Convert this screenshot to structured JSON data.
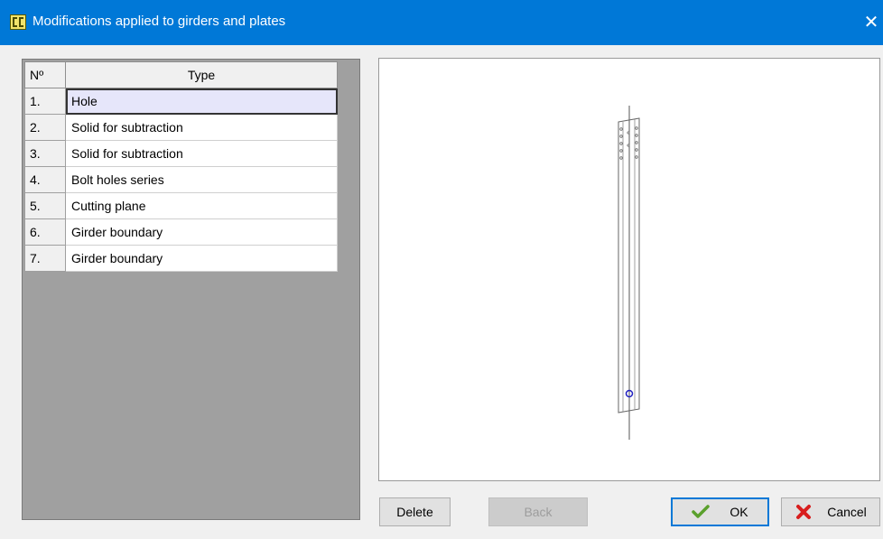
{
  "window": {
    "title": "Modifications applied to girders and plates",
    "close_glyph": "✕"
  },
  "table": {
    "headers": {
      "number": "Nº",
      "type": "Type"
    },
    "rows": [
      {
        "num": "1.",
        "type": "Hole"
      },
      {
        "num": "2.",
        "type": "Solid for subtraction"
      },
      {
        "num": "3.",
        "type": "Solid for subtraction"
      },
      {
        "num": "4.",
        "type": "Bolt holes series"
      },
      {
        "num": "5.",
        "type": "Cutting plane"
      },
      {
        "num": "6.",
        "type": "Girder boundary"
      },
      {
        "num": "7.",
        "type": "Girder boundary"
      }
    ],
    "selected_row": 0
  },
  "buttons": {
    "delete": "Delete",
    "back": "Back",
    "ok": "OK",
    "cancel": "Cancel"
  },
  "colors": {
    "titlebar": "#0078d7",
    "selection": "#e6e6fa",
    "ok_check": "#5aa02c",
    "cancel_x": "#d81e1e",
    "hole_marker": "#2020c0"
  }
}
